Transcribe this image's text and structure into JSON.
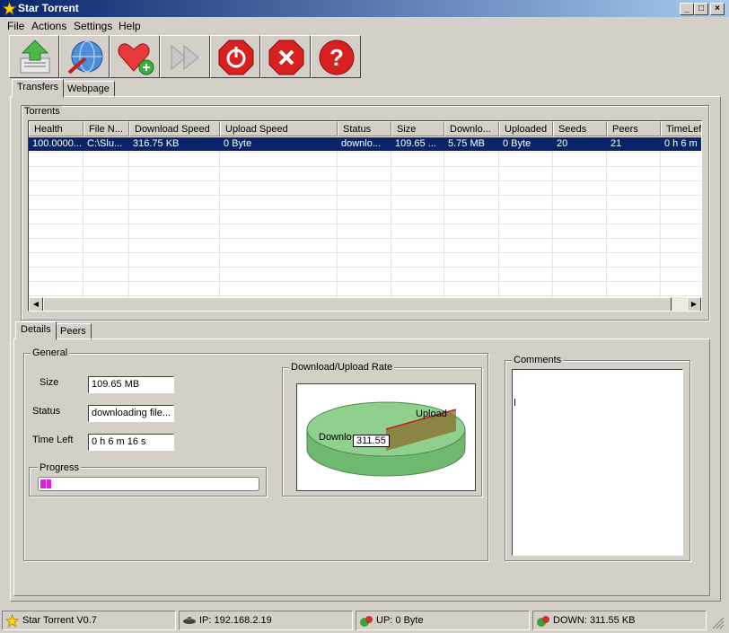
{
  "window": {
    "title": "Star Torrent"
  },
  "menu": [
    "File",
    "Actions",
    "Settings",
    "Help"
  ],
  "toolbar": [
    {
      "name": "open-torrent-icon"
    },
    {
      "name": "web-search-icon"
    },
    {
      "name": "add-favorite-icon"
    },
    {
      "name": "forward-icon"
    },
    {
      "name": "power-icon"
    },
    {
      "name": "stop-icon"
    },
    {
      "name": "help-icon"
    }
  ],
  "main_tabs": [
    "Transfers",
    "Webpage"
  ],
  "torrents": {
    "label": "Torrents",
    "columns": [
      "Health",
      "File N...",
      "Download Speed",
      "Upload Speed",
      "Status",
      "Size",
      "Downlo...",
      "Uploaded",
      "Seeds",
      "Peers",
      "TimeLef"
    ],
    "rows": [
      [
        "100.0000...",
        "C:\\Slu...",
        "316.75 KB",
        "0 Byte",
        "downlo...",
        "109.65 ...",
        "5.75 MB",
        "0 Byte",
        "20",
        "21",
        "0 h 6 m"
      ]
    ]
  },
  "detail_tabs": [
    "Details",
    "Peers"
  ],
  "general": {
    "label": "General",
    "size_label": "Size",
    "size_value": "109.65 MB",
    "status_label": "Status",
    "status_value": "downloading file...",
    "timeleft_label": "Time Left",
    "timeleft_value": "0 h 6 m 16 s",
    "progress_label": "Progress",
    "progress_fraction": 0.05
  },
  "rate_chart": {
    "label": "Download/Upload Rate",
    "upload_label": "Upload",
    "download_label": "Downlo",
    "tooltip": "311.55"
  },
  "comments": {
    "label": "Comments"
  },
  "statusbar": {
    "app": "Star Torrent V0.7",
    "ip": "IP: 192.168.2.19",
    "up": "UP: 0 Byte",
    "down": "DOWN: 311.55 KB"
  },
  "colors": {
    "titlebar": "#0a246a",
    "selection": "#0a246a",
    "progress": "#e020e0",
    "chart_fill": "#7cc47c"
  }
}
